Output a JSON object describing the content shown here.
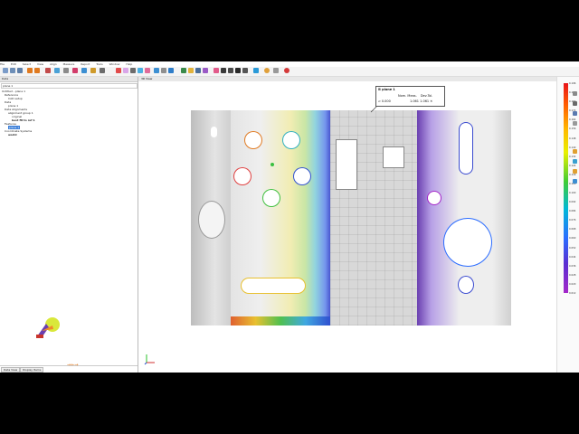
{
  "menu": [
    "File",
    "Edit",
    "Select",
    "View",
    "Align",
    "Measure",
    "Report",
    "Tools",
    "Window",
    "Help"
  ],
  "sidebar": {
    "panel_title": "Data",
    "search": "plane 1",
    "tree": [
      "Untitled - plane 1",
      "Reference",
      "CAD setup",
      "Data",
      "plane 1",
      "Data Alignments",
      "alignment group 1",
      "original",
      "best fit to ref 1",
      "Features",
      "plane 1",
      "Coordinate Systems",
      "world"
    ],
    "tabs": [
      "Data View",
      "Display Items"
    ]
  },
  "viewport": {
    "title": "3D View",
    "callout": {
      "name": "plane 1",
      "headers": [
        "Nom.",
        "Meas.",
        "Dev.",
        "Tol."
      ],
      "values": [
        "0.000",
        "1.061",
        "1.061"
      ]
    }
  },
  "colorbar": {
    "ticks": [
      "0.196",
      "0.188",
      "0.180",
      "0.172",
      "0.164",
      "0.156",
      "0.148",
      "0.140",
      "0.132",
      "0.124",
      "0.116",
      "0.108",
      "0.100",
      "0.092",
      "0.084",
      "0.076",
      "0.068",
      "0.060",
      "0.052",
      "0.044",
      "0.036",
      "0.028",
      "0.020",
      "0.012"
    ],
    "colors": [
      "#e8141a",
      "#ff5a00",
      "#ffb800",
      "#e9f000",
      "#3fcc34",
      "#00b8d8",
      "#2b6cff",
      "#5a2ed1",
      "#a428c9"
    ]
  },
  "icons": [
    "undo-icon",
    "redo-icon",
    "open-icon",
    "save-icon",
    "fit-view-icon",
    "zoom-icon",
    "rotate-icon",
    "measure-icon",
    "camera-icon",
    "axis-triad-icon"
  ]
}
